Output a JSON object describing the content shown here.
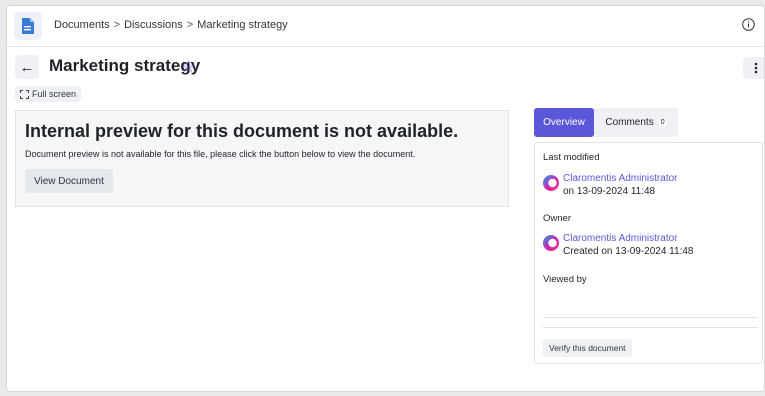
{
  "breadcrumb": {
    "items": [
      "Documents",
      "Discussions",
      "Marketing strategy"
    ],
    "separator": ">"
  },
  "document": {
    "title": "Marketing strategy"
  },
  "toolbar": {
    "fullscreen_label": "Full screen"
  },
  "preview": {
    "heading": "Internal preview for this document is not available.",
    "message": "Document preview is not available for this file, please click the button below to view the document.",
    "view_button_label": "View Document"
  },
  "tabs": [
    {
      "label": "Overview",
      "active": true
    },
    {
      "label": "Comments",
      "count": "0",
      "active": false
    }
  ],
  "overview": {
    "last_modified_label": "Last modified",
    "last_modified_user": "Claromentis Administrator",
    "last_modified_date": "on 13-09-2024 11:48",
    "owner_label": "Owner",
    "owner_user": "Claromentis Administrator",
    "owner_created": "Created on 13-09-2024 11:48",
    "viewed_by_label": "Viewed by",
    "verify_button_label": "Verify this document"
  },
  "colors": {
    "accent": "#5b57d9",
    "app_icon": "#3a7bd5"
  },
  "icons": {
    "app": "document-icon",
    "info": "info-icon",
    "back": "arrow-left-icon",
    "favorite": "star-outline-icon",
    "more": "kebab-menu-icon",
    "fullscreen": "expand-icon",
    "avatar": "user-avatar-icon"
  }
}
